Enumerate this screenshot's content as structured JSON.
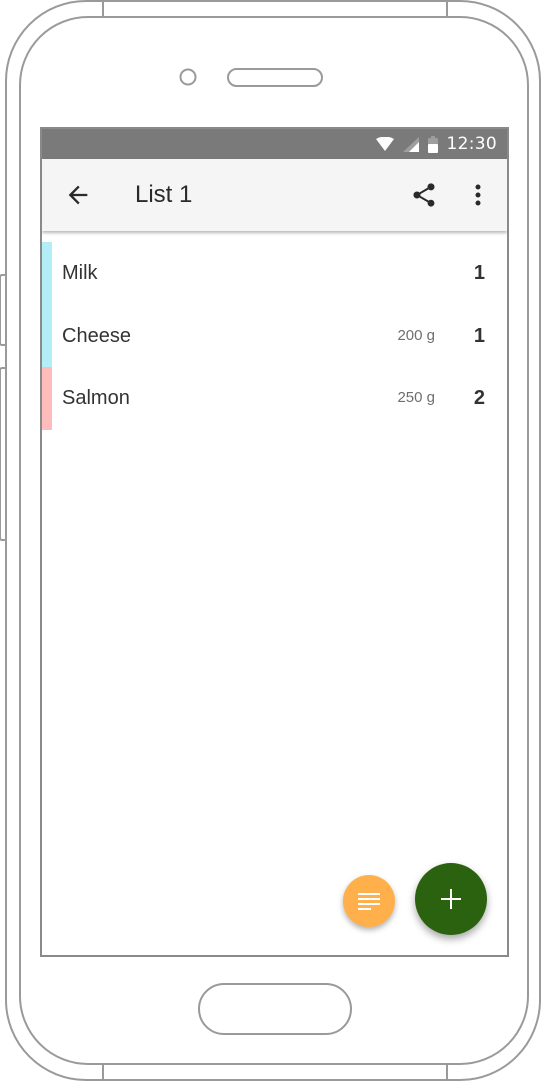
{
  "status_bar": {
    "time": "12:30",
    "icons": [
      "wifi-icon",
      "cellular-signal-icon",
      "battery-icon"
    ],
    "background": "#7a7a7a"
  },
  "app_bar": {
    "title": "List 1",
    "back_icon": "arrow-back-icon",
    "share_icon": "share-icon",
    "more_icon": "more-vert-icon",
    "background": "#f5f5f5"
  },
  "items": [
    {
      "name": "Milk",
      "amount": "",
      "quantity": "1",
      "color": "#b3eef6"
    },
    {
      "name": "Cheese",
      "amount": "200 g",
      "quantity": "1",
      "color": "#b3eef6"
    },
    {
      "name": "Salmon",
      "amount": "250 g",
      "quantity": "2",
      "color": "#ffbcbc"
    }
  ],
  "fab_secondary": {
    "icon": "notes-icon",
    "color": "#ffb04a"
  },
  "fab_primary": {
    "icon": "add-icon",
    "color": "#2a6210"
  }
}
